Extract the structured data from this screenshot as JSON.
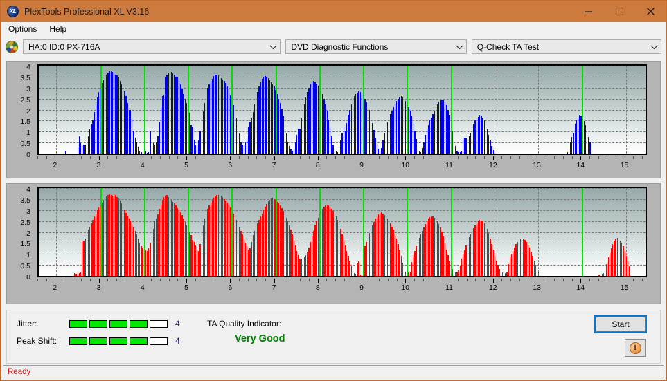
{
  "window": {
    "title": "PlexTools Professional XL V3.16",
    "app_icon": "xl-logo-icon",
    "minimize_label": "minimize-icon",
    "maximize_label": "maximize-icon",
    "close_label": "close-icon",
    "titlebar_color": "#cd7a3e"
  },
  "menu": {
    "items": [
      {
        "label": "Options"
      },
      {
        "label": "Help"
      }
    ]
  },
  "toolbar": {
    "drive_icon": "optical-disc-icon",
    "drive": {
      "value": "HA:0 ID:0  PX-716A"
    },
    "function": {
      "value": "DVD Diagnostic Functions"
    },
    "test": {
      "value": "Q-Check TA Test"
    }
  },
  "bottom": {
    "jitter_label": "Jitter:",
    "jitter_value": "4",
    "jitter_segments": 5,
    "jitter_filled": 4,
    "peak_shift_label": "Peak Shift:",
    "peak_shift_value": "4",
    "peak_shift_segments": 5,
    "peak_shift_filled": 4,
    "ta_quality_label": "TA Quality Indicator:",
    "ta_quality_value": "Very Good",
    "ta_quality_color": "#008000",
    "start_label": "Start",
    "info_label": "i"
  },
  "statusbar": {
    "text": "Ready",
    "color": "#d01414"
  },
  "chart_data": [
    {
      "id": "jitter-chart",
      "type": "bar",
      "title": "",
      "series_name": "Jitter",
      "color": "#0000dd",
      "xlabel": "",
      "ylabel": "",
      "ylim": [
        0,
        4
      ],
      "xlim": [
        1.6,
        15.45
      ],
      "yticks": [
        0,
        0.5,
        1,
        1.5,
        2,
        2.5,
        3,
        3.5,
        4
      ],
      "ytick_labels": [
        "0",
        "0.5",
        "1",
        "1.5",
        "2",
        "2.5",
        "3",
        "3.5",
        "4"
      ],
      "xticks": [
        2,
        3,
        4,
        5,
        6,
        7,
        8,
        9,
        10,
        11,
        12,
        13,
        14,
        15
      ],
      "xtick_labels": [
        "2",
        "3",
        "4",
        "5",
        "6",
        "7",
        "8",
        "9",
        "10",
        "11",
        "12",
        "13",
        "14",
        "15"
      ],
      "grid": true,
      "markers": [
        3,
        4,
        5,
        6,
        7,
        8,
        9,
        10,
        11,
        14
      ],
      "marker_color": "#00e000",
      "bar_step": 0.0345,
      "x_start": 1.72,
      "values": [
        0,
        0,
        0,
        0,
        0,
        0,
        0,
        0,
        0,
        0,
        0,
        0,
        0,
        0,
        0.12,
        0,
        0,
        0,
        0,
        0,
        0,
        0,
        0.3,
        0.78,
        0.46,
        0.42,
        0.4,
        0.42,
        0.56,
        0.78,
        1.1,
        1.35,
        1.55,
        1.9,
        2.25,
        2.55,
        2.8,
        3.0,
        3.2,
        3.35,
        3.5,
        3.6,
        3.68,
        3.74,
        3.76,
        3.72,
        3.7,
        3.6,
        3.55,
        3.46,
        3.3,
        3.15,
        3.0,
        2.85,
        2.6,
        2.3,
        2.0,
        1.98,
        1.56,
        1.0,
        0.72,
        0.52,
        0.3,
        0.12,
        0.05,
        0,
        0,
        0.1,
        0.02,
        0.05,
        1.0,
        0.62,
        0.48,
        0.42,
        0.5,
        0.78,
        1.45,
        2.1,
        2.6,
        2.68,
        3.45,
        3.55,
        3.7,
        3.74,
        3.72,
        3.65,
        3.58,
        3.5,
        3.45,
        3.3,
        3.15,
        2.95,
        2.72,
        2.5,
        2.3,
        2.1,
        1.85,
        1.3,
        1.24,
        0.6,
        0.38,
        0.42,
        0.62,
        1.05,
        1.55,
        1.92,
        2.3,
        2.72,
        3.0,
        3.15,
        3.3,
        3.4,
        3.52,
        3.58,
        3.6,
        3.56,
        3.5,
        3.44,
        3.38,
        3.3,
        3.2,
        3.05,
        2.85,
        2.65,
        2.4,
        2.2,
        1.95,
        1.6,
        1.35,
        0.9,
        0.55,
        0.4,
        0.42,
        0.55,
        0.72,
        1.2,
        1.45,
        1.6,
        1.9,
        2.25,
        2.55,
        2.8,
        3.05,
        3.25,
        3.4,
        3.48,
        3.52,
        3.5,
        3.44,
        3.35,
        3.26,
        3.15,
        3.05,
        2.9,
        2.72,
        2.5,
        2.3,
        2.05,
        1.7,
        1.3,
        0.9,
        0.55,
        0.35,
        0.2,
        0.12,
        0.2,
        0.5,
        0.85,
        1.15,
        1.15,
        1.6,
        1.95,
        2.25,
        2.55,
        2.8,
        3.0,
        3.15,
        3.25,
        3.3,
        3.25,
        3.18,
        3.1,
        3.0,
        2.85,
        2.7,
        2.5,
        2.25,
        1.95,
        1.55,
        1.2,
        0.8,
        0.4,
        0.18,
        0.08,
        0.06,
        0.22,
        0.6,
        0.9,
        1.2,
        1.05,
        1.4,
        1.75,
        2.0,
        2.25,
        2.45,
        2.6,
        2.7,
        2.78,
        2.82,
        2.8,
        2.72,
        2.6,
        2.5,
        2.35,
        2.2,
        1.98,
        1.7,
        1.4,
        1.08,
        0.7,
        0.38,
        0.2,
        0.1,
        0.25,
        0.6,
        0.95,
        1.2,
        1.42,
        1.6,
        1.78,
        1.95,
        2.1,
        2.25,
        2.38,
        2.5,
        2.56,
        2.6,
        2.56,
        2.48,
        2.38,
        2.25,
        2.1,
        1.95,
        1.7,
        1.42,
        1.05,
        0.65,
        0.3,
        0.12,
        0.05,
        0.25,
        0.55,
        0.85,
        1.1,
        1.3,
        1.5,
        1.65,
        1.8,
        1.95,
        2.1,
        2.25,
        2.35,
        2.42,
        2.45,
        2.42,
        2.35,
        2.2,
        2.0,
        1.72,
        1.4,
        1.05,
        0.7,
        0.35,
        0.12,
        0.05,
        0.05,
        0.1,
        0.72,
        0.7,
        0.7,
        0.72,
        0.8,
        0.95,
        1.15,
        1.35,
        1.5,
        1.6,
        1.68,
        1.72,
        1.7,
        1.62,
        1.5,
        1.32,
        1.1,
        0.85,
        0.6,
        0.35,
        0.15,
        0.05,
        0,
        0,
        0,
        0,
        0,
        0,
        0,
        0,
        0,
        0,
        0,
        0,
        0,
        0,
        0,
        0,
        0,
        0,
        0,
        0,
        0,
        0,
        0,
        0,
        0,
        0,
        0,
        0,
        0,
        0,
        0,
        0,
        0,
        0,
        0,
        0,
        0,
        0,
        0,
        0,
        0,
        0,
        0,
        0,
        0,
        0,
        0,
        0.05,
        0.1,
        0.55,
        0.75,
        0.95,
        1.35,
        1.5,
        1.65,
        1.72,
        1.7,
        1.6,
        1.48,
        1.28,
        1.0,
        0.75,
        0.55,
        0,
        0,
        0,
        0,
        0,
        0,
        0,
        0,
        0,
        0,
        0,
        0,
        0,
        0,
        0,
        0,
        0,
        0,
        0,
        0,
        0,
        0,
        0,
        0,
        0,
        0,
        0,
        0,
        0,
        0,
        0,
        0,
        0,
        0,
        0,
        0,
        0,
        0,
        0,
        0,
        0,
        0
      ]
    },
    {
      "id": "peak-shift-chart",
      "type": "bar",
      "title": "",
      "series_name": "Peak Shift",
      "color": "#ff0000",
      "xlabel": "",
      "ylabel": "",
      "ylim": [
        0,
        4
      ],
      "xlim": [
        1.6,
        15.45
      ],
      "yticks": [
        0,
        0.5,
        1,
        1.5,
        2,
        2.5,
        3,
        3.5,
        4
      ],
      "ytick_labels": [
        "0",
        "0.5",
        "1",
        "1.5",
        "2",
        "2.5",
        "3",
        "3.5",
        "4"
      ],
      "xticks": [
        2,
        3,
        4,
        5,
        6,
        7,
        8,
        9,
        10,
        11,
        12,
        13,
        14,
        15
      ],
      "xtick_labels": [
        "2",
        "3",
        "4",
        "5",
        "6",
        "7",
        "8",
        "9",
        "10",
        "11",
        "12",
        "13",
        "14",
        "15"
      ],
      "grid": true,
      "markers": [
        3,
        4,
        5,
        6,
        7,
        8,
        9,
        10,
        11,
        14
      ],
      "marker_color": "#00e000",
      "bar_step": 0.0345,
      "x_start": 1.72,
      "values": [
        0,
        0,
        0,
        0,
        0,
        0,
        0,
        0,
        0,
        0,
        0,
        0,
        0,
        0,
        0,
        0,
        0,
        0,
        0,
        0.08,
        0.12,
        0.1,
        0.14,
        0.12,
        0.16,
        1.55,
        1.6,
        1.7,
        1.85,
        2.1,
        2.25,
        2.4,
        2.55,
        2.7,
        2.85,
        3.0,
        3.12,
        3.22,
        3.35,
        3.45,
        3.55,
        3.62,
        3.68,
        3.72,
        3.7,
        3.66,
        3.72,
        3.68,
        3.6,
        3.52,
        3.42,
        3.3,
        3.15,
        3.0,
        2.88,
        2.75,
        2.6,
        2.48,
        2.35,
        2.2,
        2.05,
        1.88,
        1.7,
        1.52,
        1.35,
        1.25,
        1.3,
        1.18,
        1.12,
        1.25,
        1.5,
        1.85,
        2.15,
        2.5,
        2.6,
        2.8,
        3.05,
        3.25,
        3.45,
        3.58,
        3.65,
        3.68,
        3.6,
        3.5,
        3.45,
        3.38,
        3.3,
        3.2,
        3.1,
        3.0,
        2.9,
        2.78,
        2.6,
        2.45,
        2.3,
        2.15,
        2.0,
        1.85,
        1.65,
        1.55,
        1.4,
        1.2,
        1.15,
        1.45,
        1.9,
        2.3,
        2.6,
        2.85,
        3.05,
        3.2,
        3.35,
        3.45,
        3.55,
        3.62,
        3.68,
        3.7,
        3.68,
        3.65,
        3.58,
        3.5,
        3.42,
        3.35,
        3.25,
        3.12,
        3.0,
        2.85,
        2.7,
        2.55,
        2.4,
        2.25,
        2.05,
        1.9,
        1.7,
        1.5,
        1.35,
        1.2,
        1.25,
        1.55,
        1.85,
        2.05,
        2.25,
        2.4,
        2.55,
        2.7,
        2.85,
        3.0,
        3.15,
        3.28,
        3.4,
        3.48,
        3.52,
        3.55,
        3.5,
        3.45,
        3.38,
        3.3,
        3.2,
        3.1,
        2.95,
        2.8,
        2.65,
        2.5,
        2.3,
        2.12,
        1.9,
        1.65,
        1.4,
        1.15,
        0.95,
        0.8,
        0.8,
        0.85,
        0.85,
        0.95,
        1.1,
        1.3,
        1.55,
        1.8,
        2.05,
        2.3,
        2.5,
        2.65,
        2.8,
        2.95,
        3.05,
        3.15,
        3.2,
        3.25,
        3.2,
        3.15,
        3.05,
        2.95,
        2.85,
        2.7,
        2.55,
        2.35,
        2.15,
        1.9,
        1.65,
        1.4,
        1.15,
        0.9,
        0.65,
        0.45,
        0.25,
        0.12,
        0.08,
        0.6,
        0.65,
        0.05,
        0.05,
        1.15,
        1.35,
        1.55,
        1.75,
        1.95,
        2.15,
        2.3,
        2.45,
        2.6,
        2.7,
        2.8,
        2.88,
        2.9,
        2.85,
        2.78,
        2.7,
        2.6,
        2.5,
        2.38,
        2.25,
        2.1,
        1.9,
        1.7,
        1.45,
        1.2,
        0.9,
        0.6,
        0.35,
        0.18,
        0.12,
        0.15,
        0.2,
        0.62,
        0.95,
        1.15,
        1.35,
        1.55,
        1.72,
        1.9,
        2.05,
        2.2,
        2.35,
        2.5,
        2.6,
        2.68,
        2.72,
        2.7,
        2.65,
        2.58,
        2.48,
        2.35,
        2.2,
        2.0,
        1.78,
        1.5,
        1.2,
        0.95,
        0.7,
        0.5,
        0.3,
        0.2,
        0.15,
        0.18,
        0.25,
        0.48,
        0.8,
        1.0,
        1.2,
        1.4,
        1.58,
        1.75,
        1.9,
        2.05,
        2.18,
        2.3,
        2.4,
        2.48,
        2.55,
        2.52,
        2.48,
        2.4,
        2.3,
        2.15,
        1.95,
        1.7,
        1.45,
        1.2,
        0.95,
        0.7,
        0.5,
        0.32,
        0.18,
        0.15,
        0.3,
        0.12,
        0.18,
        0.55,
        0.85,
        1.0,
        1.15,
        1.3,
        1.45,
        1.55,
        1.62,
        1.68,
        1.72,
        1.7,
        1.65,
        1.55,
        1.42,
        1.28,
        1.1,
        0.9,
        0.7,
        0.52,
        0.35,
        0.2,
        0,
        0,
        0,
        0,
        0,
        0,
        0,
        0,
        0,
        0,
        0,
        0,
        0,
        0,
        0,
        0,
        0,
        0,
        0,
        0,
        0,
        0,
        0,
        0,
        0,
        0,
        0,
        0,
        0,
        0,
        0,
        0,
        0,
        0,
        0,
        0,
        0,
        0,
        0,
        0.05,
        0.08,
        0.1,
        0.12,
        0.12,
        0.55,
        0.85,
        1.05,
        1.25,
        1.45,
        1.6,
        1.7,
        1.74,
        1.7,
        1.62,
        1.5,
        1.35,
        1.15,
        0.9,
        0.65,
        0.45,
        0,
        0,
        0,
        0,
        0,
        0,
        0,
        0,
        0,
        0,
        0,
        0,
        0,
        0,
        0,
        0,
        0,
        0,
        0,
        0,
        0,
        0,
        0,
        0,
        0,
        0,
        0,
        0,
        0,
        0,
        0,
        0,
        0,
        0,
        0,
        0,
        0,
        0,
        0,
        0
      ]
    }
  ]
}
